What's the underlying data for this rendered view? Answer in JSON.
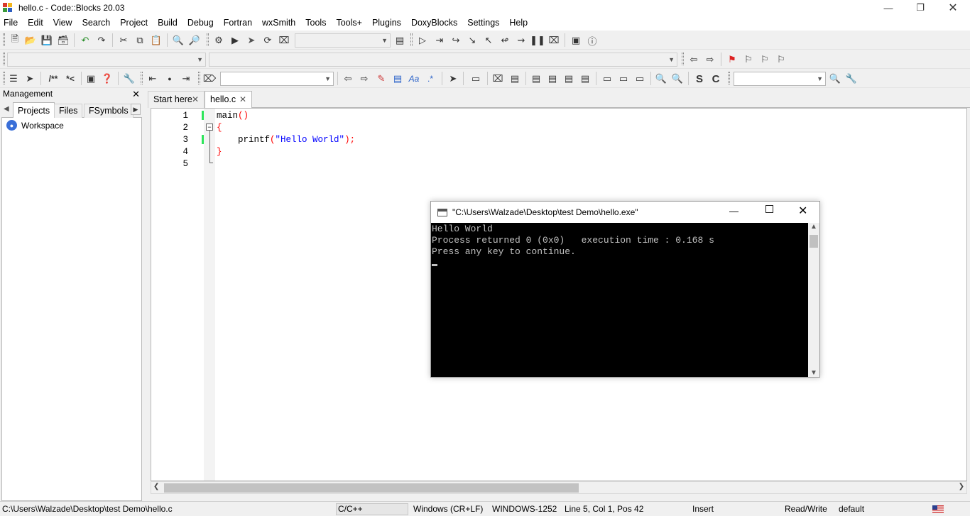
{
  "window": {
    "title": "hello.c - Code::Blocks 20.03"
  },
  "menu": [
    "File",
    "Edit",
    "View",
    "Search",
    "Project",
    "Build",
    "Debug",
    "Fortran",
    "wxSmith",
    "Tools",
    "Tools+",
    "Plugins",
    "DoxyBlocks",
    "Settings",
    "Help"
  ],
  "management": {
    "title": "Management",
    "tabs": [
      "Projects",
      "Files",
      "FSymbols"
    ],
    "workspace": "Workspace"
  },
  "editor": {
    "tabs": [
      "Start here",
      "hello.c"
    ],
    "line_numbers": [
      "1",
      "2",
      "3",
      "4",
      "5"
    ],
    "code": {
      "l1_fn": "main",
      "l1_paren": "()",
      "l2": "{",
      "l3_indent": "    ",
      "l3_fn": "printf",
      "l3_open": "(",
      "l3_str": "\"Hello World\"",
      "l3_close": ");",
      "l4": "}"
    }
  },
  "console": {
    "title": "\"C:\\Users\\Walzade\\Desktop\\test Demo\\hello.exe\"",
    "lines": [
      "Hello World",
      "Process returned 0 (0x0)   execution time : 0.168 s",
      "Press any key to continue."
    ]
  },
  "toolbar": {
    "text_glyphs": [
      "/**",
      "*<",
      "S",
      "C",
      "Aa",
      ".*"
    ]
  },
  "status": {
    "path": "C:\\Users\\Walzade\\Desktop\\test Demo\\hello.c",
    "lang": "C/C++",
    "eol": "Windows (CR+LF)",
    "encoding": "WINDOWS-1252",
    "position": "Line 5, Col 1, Pos 42",
    "mode": "Insert",
    "access": "Read/Write",
    "profile": "default"
  },
  "colors": {
    "keyword_fn": "#000000",
    "brace": "#ff0000",
    "string": "#0000ff",
    "changebar": "#2ee55a",
    "console_bg": "#000000",
    "console_fg": "#c0c0c0"
  }
}
